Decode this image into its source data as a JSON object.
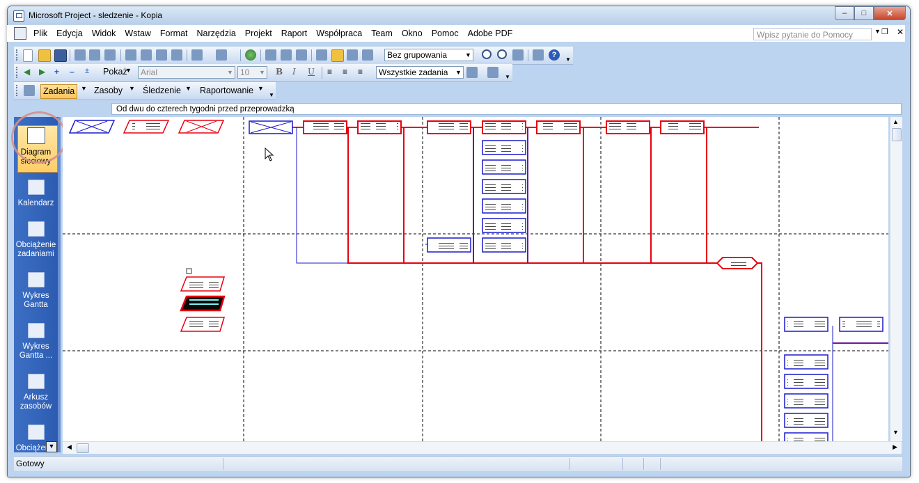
{
  "window": {
    "title": "Microsoft Project - sledzenie - Kopia"
  },
  "menu": {
    "items": [
      "Plik",
      "Edycja",
      "Widok",
      "Wstaw",
      "Format",
      "Narzędzia",
      "Projekt",
      "Raport",
      "Współpraca",
      "Team",
      "Okno",
      "Pomoc",
      "Adobe PDF"
    ],
    "help_placeholder": "Wpisz pytanie do Pomocy"
  },
  "toolbar_standard": {
    "grouping": "Bez grupowania"
  },
  "toolbar_format": {
    "show_label": "Pokaż",
    "font": "Arial",
    "font_size": "10",
    "bold": "B",
    "italic": "I",
    "underline": "U",
    "filter": "Wszystkie zadania"
  },
  "guide_toolbar": {
    "tabs": [
      "Zadania",
      "Zasoby",
      "Śledzenie",
      "Raportowanie"
    ],
    "active": "Zadania"
  },
  "entry_bar": {
    "text": "Od dwu do czterech tygodni przed przeprowadzką"
  },
  "view_bar": {
    "items": [
      {
        "label": "Diagram sieciowy",
        "icon": "network-diagram-icon",
        "selected": true
      },
      {
        "label": "Kalendarz",
        "icon": "calendar-icon",
        "selected": false
      },
      {
        "label": "Obciążenie zadaniami",
        "icon": "task-usage-icon",
        "selected": false
      },
      {
        "label": "Wykres Gantta",
        "icon": "gantt-chart-icon",
        "selected": false
      },
      {
        "label": "Wykres Gantta ...",
        "icon": "tracking-gantt-icon",
        "selected": false
      },
      {
        "label": "Arkusz zasobów",
        "icon": "resource-sheet-icon",
        "selected": false
      },
      {
        "label": "Obciążenie",
        "icon": "resource-usage-icon",
        "selected": false
      }
    ]
  },
  "network": {
    "accent_critical": "#e8000f",
    "accent_normal": "#1a1acc",
    "accent_summary": "#6a1a9a"
  },
  "status": {
    "text": "Gotowy"
  }
}
